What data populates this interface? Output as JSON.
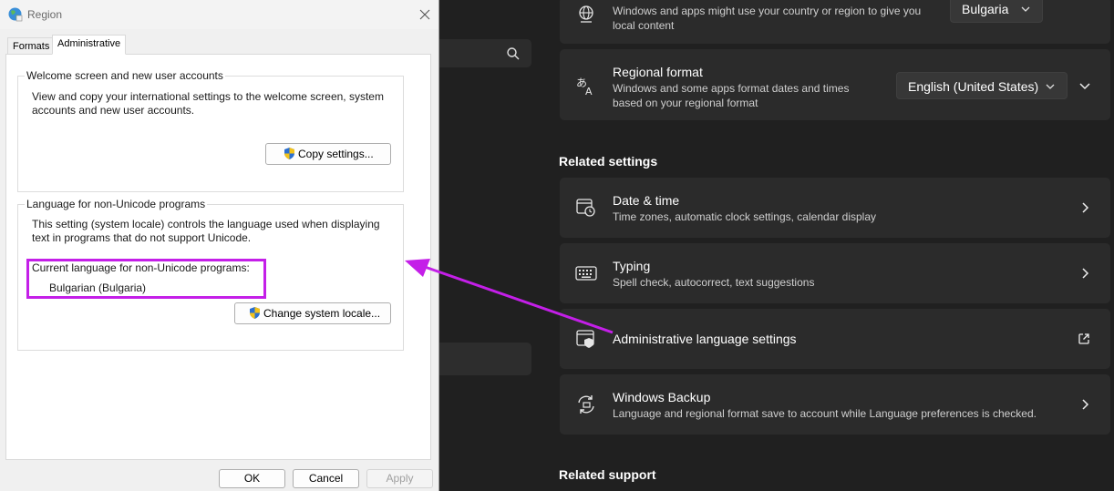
{
  "settings": {
    "country_card": {
      "subtitle": "Windows and apps might use your country or region to give you local content",
      "value": "Bulgaria"
    },
    "regional_format": {
      "title": "Regional format",
      "subtitle": "Windows and some apps format dates and times based on your regional format",
      "value": "English (United States)"
    },
    "related_settings_heading": "Related settings",
    "related": [
      {
        "title": "Date & time",
        "subtitle": "Time zones, automatic clock settings, calendar display"
      },
      {
        "title": "Typing",
        "subtitle": "Spell check, autocorrect, text suggestions"
      },
      {
        "title": "Administrative language settings"
      },
      {
        "title": "Windows Backup",
        "subtitle": "Language and regional format save to account while Language preferences is checked."
      }
    ],
    "related_support_heading": "Related support"
  },
  "dialog": {
    "title": "Region",
    "tabs": [
      "Formats",
      "Administrative"
    ],
    "welcome_group": {
      "legend": "Welcome screen and new user accounts",
      "description": "View and copy your international settings to the welcome screen, system accounts and new user accounts.",
      "button": "Copy settings..."
    },
    "unicode_group": {
      "legend": "Language for non-Unicode programs",
      "description": "This setting (system locale) controls the language used when displaying text in programs that do not support Unicode.",
      "current_label": "Current language for non-Unicode programs:",
      "current_value": "Bulgarian (Bulgaria)",
      "button": "Change system locale..."
    },
    "buttons": {
      "ok": "OK",
      "cancel": "Cancel",
      "apply": "Apply"
    }
  },
  "annotation": {
    "color": "#c41fe8"
  },
  "colors": {
    "settings_bg": "#202020",
    "card_bg": "#2b2b2b",
    "accent_highlight": "#c41fe8"
  }
}
